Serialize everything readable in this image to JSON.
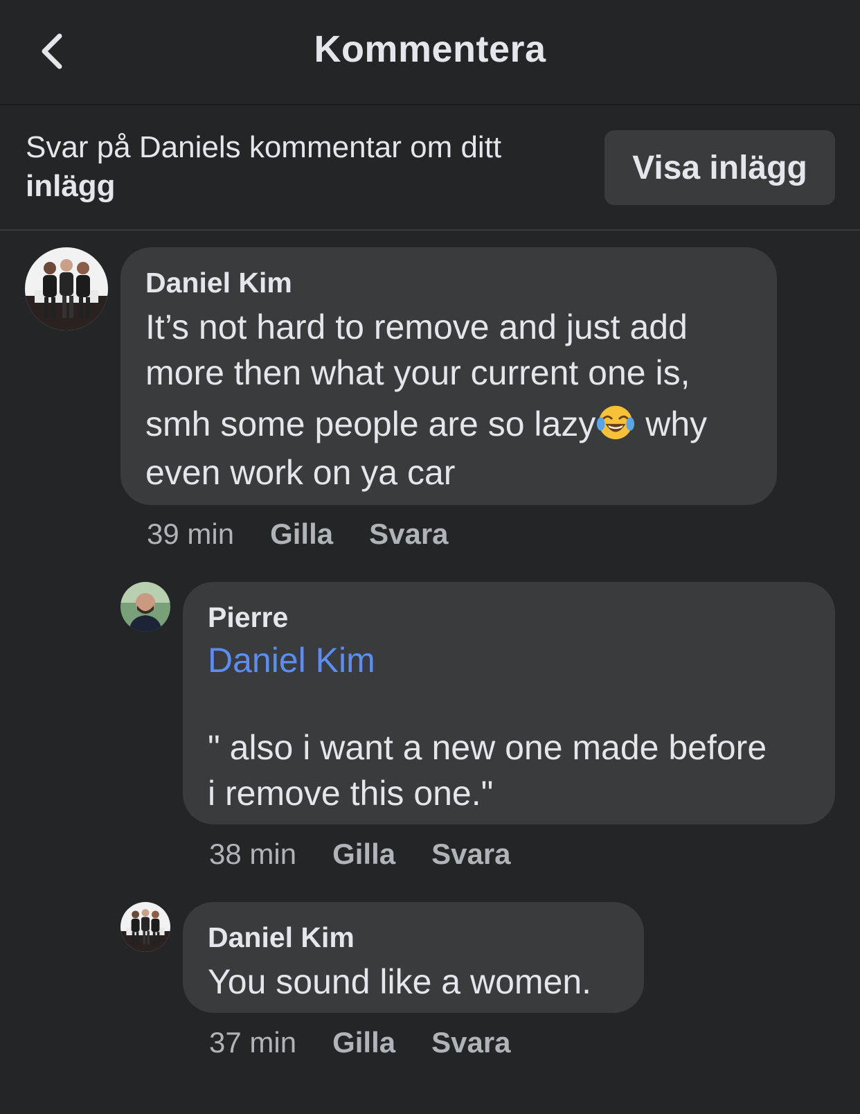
{
  "header": {
    "title": "Kommentera"
  },
  "context": {
    "text_plain": "Svar på Daniels kommentar om ditt ",
    "text_bold": "inlägg",
    "button_label": "Visa inlägg"
  },
  "comments": [
    {
      "author": "Daniel Kim",
      "lines": [
        "It’s not hard to remove and just add",
        "more then what your current one is,",
        "smh some people are so lazy",
        " why",
        "even work on ya car"
      ],
      "emoji": "face-with-tears-of-joy-icon",
      "time": "39 min",
      "like": "Gilla",
      "reply": "Svara"
    },
    {
      "author": "Pierre",
      "mention": "Daniel Kim",
      "lines": [
        "\" also i want a new one made before",
        "i remove this one.\""
      ],
      "time": "38 min",
      "like": "Gilla",
      "reply": "Svara"
    },
    {
      "author": "Daniel Kim",
      "lines": [
        "You sound like a women."
      ],
      "time": "37 min",
      "like": "Gilla",
      "reply": "Svara"
    }
  ],
  "colors": {
    "background": "#242526",
    "bubble": "#3a3b3c",
    "text": "#e4e6eb",
    "secondary": "#b0b3b8",
    "mention": "#5b8ef0"
  }
}
